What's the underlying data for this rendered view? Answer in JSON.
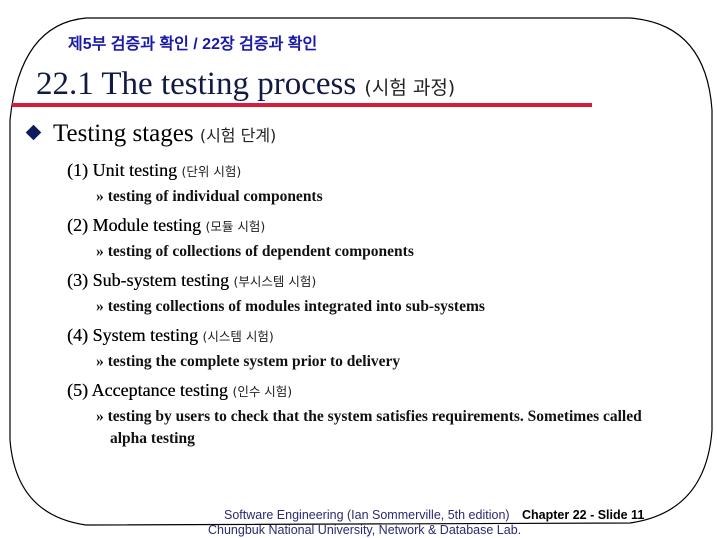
{
  "header": {
    "subtitle": "제5부 검증과 확인 / 22장 검증과 확인",
    "title_en": "22.1 The testing process",
    "title_ko": "(시험 과정)"
  },
  "colors": {
    "subtitle": "#1a1aa6",
    "title": "#0f1a45",
    "rule": "#d81b3a",
    "bullet": "#0d1b5c"
  },
  "bullet": {
    "icon": "diamond-bullet-icon",
    "label_en": "Testing stages",
    "label_ko": "(시험 단계)"
  },
  "stages": [
    {
      "label_en": "(1) Unit testing",
      "label_ko": "(단위 시험)",
      "marker": "»",
      "desc": "testing of individual components"
    },
    {
      "label_en": "(2) Module testing",
      "label_ko": "(모듈 시험)",
      "marker": "»",
      "desc": "testing of collections of dependent components"
    },
    {
      "label_en": "(3) Sub-system testing",
      "label_ko": "(부시스템 시험)",
      "marker": "»",
      "desc": "testing collections of modules integrated into sub-systems"
    },
    {
      "label_en": "(4) System testing",
      "label_ko": "(시스템 시험)",
      "marker": "»",
      "desc": "testing the complete system prior to delivery"
    },
    {
      "label_en": "(5) Acceptance testing",
      "label_ko": "(인수 시험)",
      "marker": "»",
      "desc": "testing by users to check that the system satisfies requirements. Sometimes called",
      "desc_cont": "alpha testing"
    }
  ],
  "footer": {
    "book": "Software Engineering (Ian Sommerville, 5th edition)",
    "slide": "Chapter 22 - Slide 11",
    "lab": "Chungbuk National University, Network & Database Lab."
  }
}
